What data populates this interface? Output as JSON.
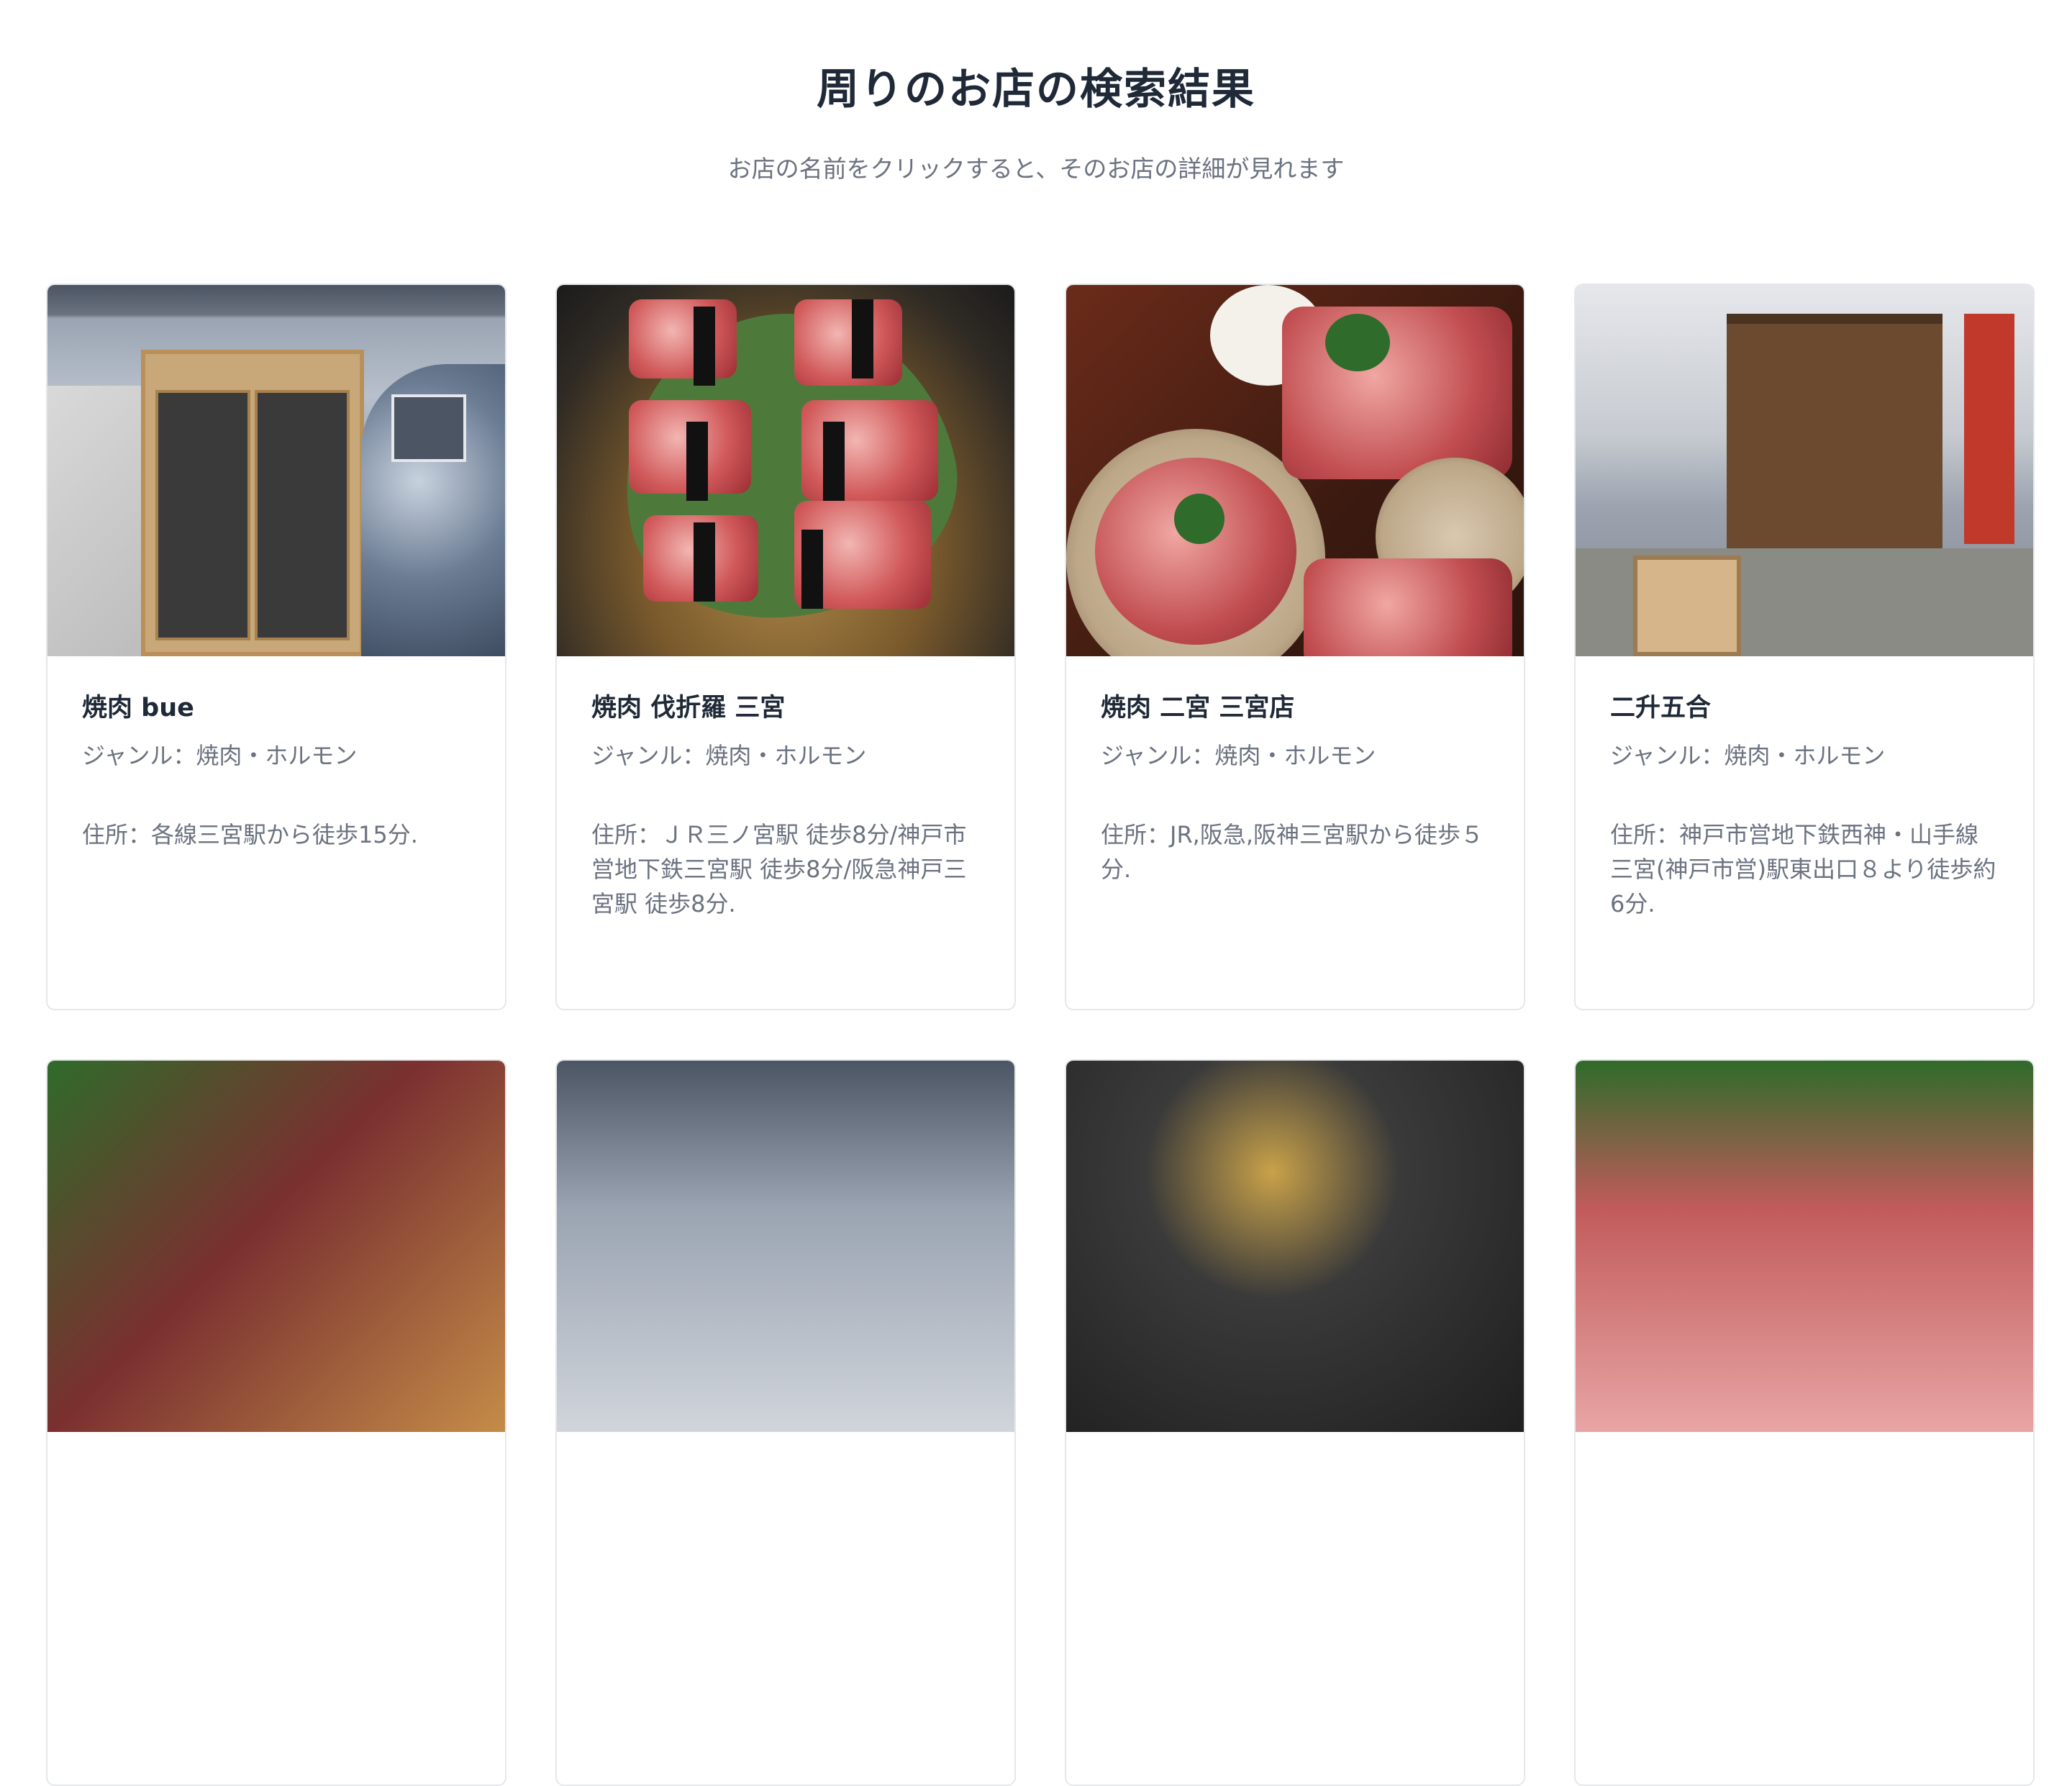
{
  "page": {
    "title": "周りのお店の検索結果",
    "subtitle": "お店の名前をクリックすると、そのお店の詳細が見れます"
  },
  "shops": [
    {
      "name": "焼肉 bue",
      "genre": "ジャンル：焼肉・ホルモン",
      "address": "住所：各線三宮駅から徒歩15分."
    },
    {
      "name": "焼肉 伐折羅 三宮",
      "genre": "ジャンル：焼肉・ホルモン",
      "address": "住所：ＪＲ三ノ宮駅 徒歩8分/神戸市営地下鉄三宮駅 徒歩8分/阪急神戸三宮駅 徒歩8分."
    },
    {
      "name": "焼肉 二宮 三宮店",
      "genre": "ジャンル：焼肉・ホルモン",
      "address": "住所：JR,阪急,阪神三宮駅から徒歩５分."
    },
    {
      "name": "二升五合",
      "genre": "ジャンル：焼肉・ホルモン",
      "address": "住所：神戸市営地下鉄西神・山手線 三宮(神戸市営)駅東出口８より徒歩約6分."
    }
  ]
}
